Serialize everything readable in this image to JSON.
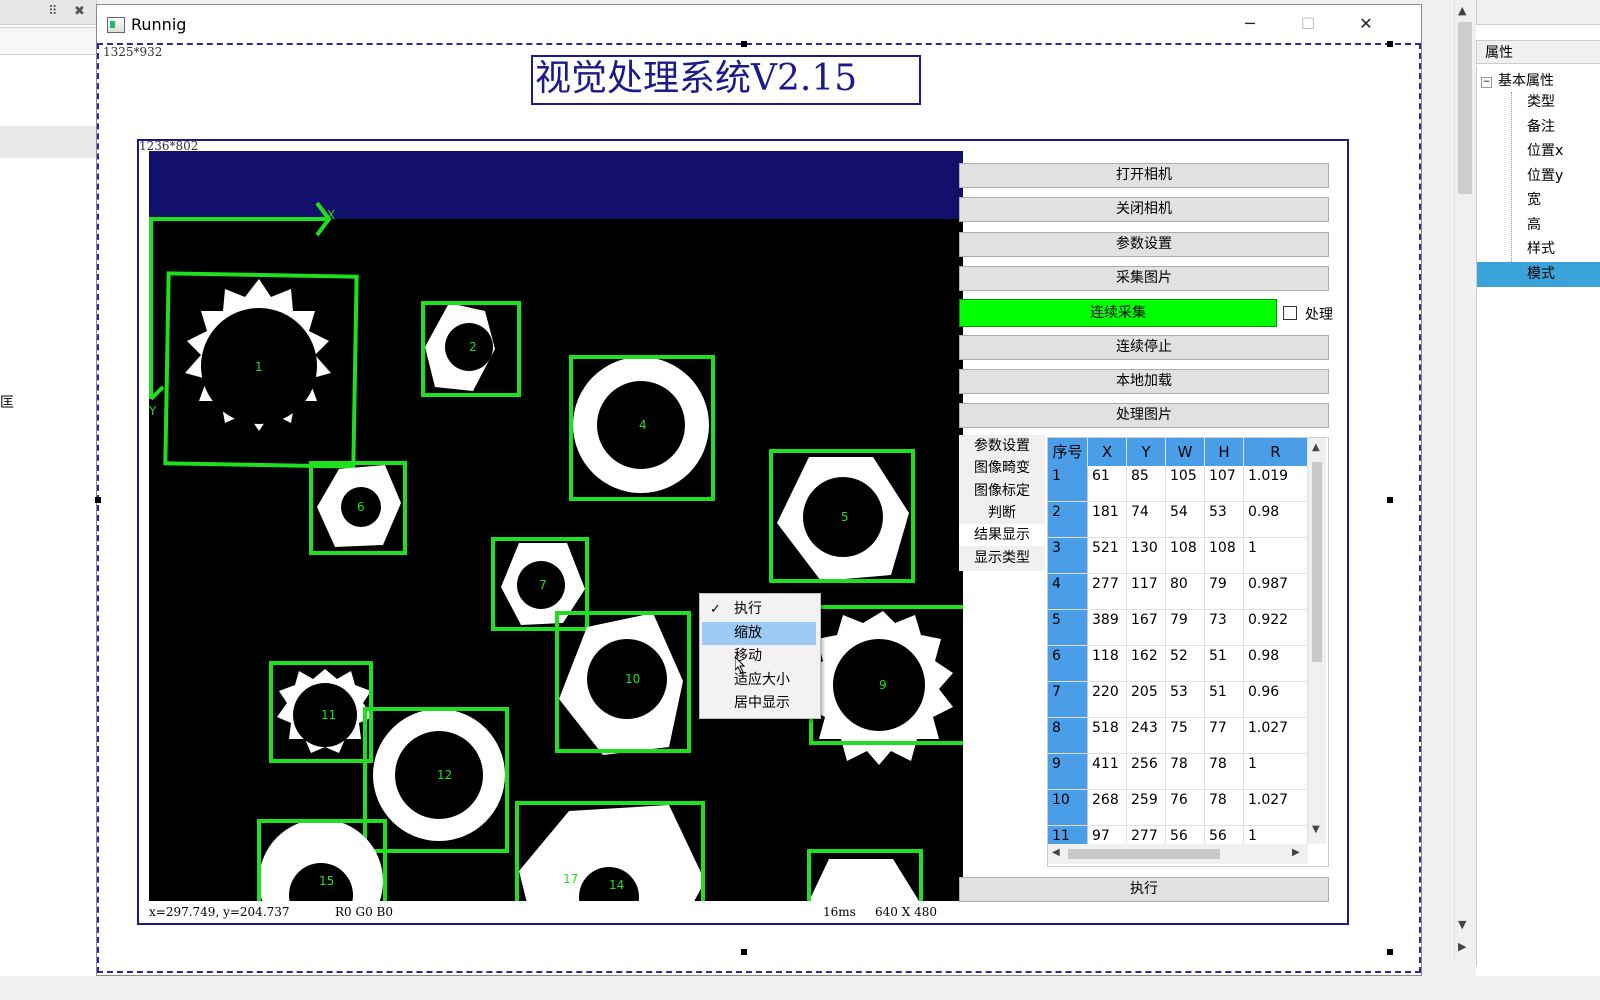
{
  "window": {
    "title": "Runnig",
    "minimize": "─",
    "maximize": "☐",
    "close": "✕"
  },
  "left_panel": {
    "fragment": "匡",
    "icon_grid": "⠿",
    "icon_close": "✖"
  },
  "canvas": {
    "outer_size_label": "1325*932",
    "inner_size_label": "1236*802",
    "app_title": "视觉处理系统V2.15"
  },
  "image_view": {
    "axis_x": "X",
    "axis_y": "Y",
    "status_coords": "x=297.749, y=204.737",
    "status_rgb": "R0 G0 B0",
    "status_time": "16ms",
    "status_resolution": "640 X 480",
    "objects": [
      "1",
      "2",
      "4",
      "6",
      "5",
      "7",
      "9",
      "10",
      "11",
      "12",
      "15",
      "17",
      "14"
    ]
  },
  "context_menu": {
    "items": [
      "执行",
      "缩放",
      "移动",
      "适应大小",
      "居中显示"
    ],
    "checked": "执行",
    "highlighted": "缩放",
    "check_mark": "✓"
  },
  "controls": {
    "open_camera": "打开相机",
    "close_camera": "关闭相机",
    "param_settings": "参数设置",
    "capture_image": "采集图片",
    "continuous_capture": "连续采集",
    "process_checkbox_label": "处理",
    "continuous_stop": "连续停止",
    "local_load": "本地加载",
    "process_image": "处理图片",
    "execute": "执行",
    "accent_green": "#00ff00"
  },
  "side_tabs": [
    "参数设置",
    "图像畸变",
    "图像标定",
    "判断",
    "结果显示",
    "显示类型"
  ],
  "result_table": {
    "columns": [
      "序号",
      "X",
      "Y",
      "W",
      "H",
      "R"
    ],
    "rows": [
      [
        "1",
        "61",
        "85",
        "105",
        "107",
        "1.019"
      ],
      [
        "2",
        "181",
        "74",
        "54",
        "53",
        "0.98"
      ],
      [
        "3",
        "521",
        "130",
        "108",
        "108",
        "1"
      ],
      [
        "4",
        "277",
        "117",
        "80",
        "79",
        "0.987"
      ],
      [
        "5",
        "389",
        "167",
        "79",
        "73",
        "0.922"
      ],
      [
        "6",
        "118",
        "162",
        "52",
        "51",
        "0.98"
      ],
      [
        "7",
        "220",
        "205",
        "53",
        "51",
        "0.96"
      ],
      [
        "8",
        "518",
        "243",
        "75",
        "77",
        "1.027"
      ],
      [
        "9",
        "411",
        "256",
        "78",
        "78",
        "1"
      ],
      [
        "10",
        "268",
        "259",
        "76",
        "78",
        "1.027"
      ],
      [
        "11",
        "97",
        "277",
        "56",
        "56",
        "1"
      ]
    ],
    "header_color": "#4a9ee8"
  },
  "properties": {
    "header": "属性",
    "group": "基本属性",
    "items": [
      "类型",
      "备注",
      "位置x",
      "位置y",
      "宽",
      "高",
      "样式",
      "模式"
    ],
    "selected": "模式"
  }
}
